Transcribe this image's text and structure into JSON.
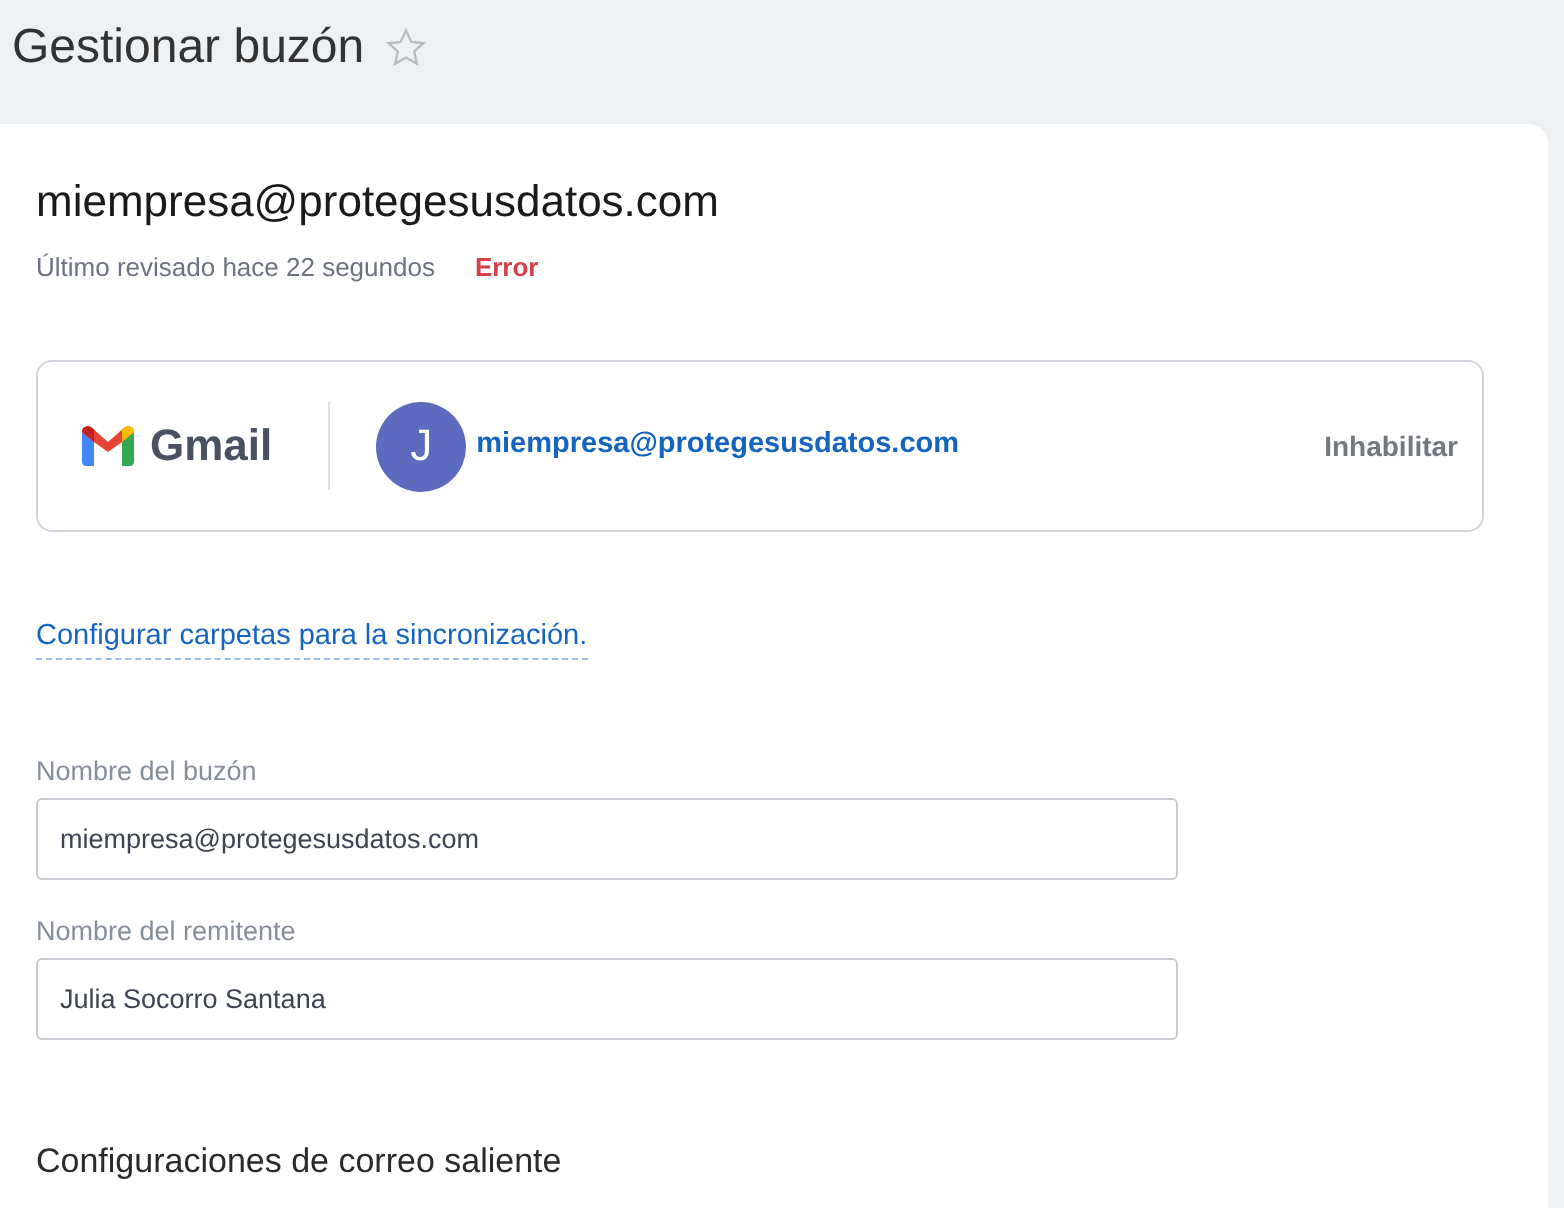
{
  "page": {
    "title": "Gestionar buzón",
    "favorite": false
  },
  "mailbox": {
    "address": "miempresa@protegesusdatos.com",
    "last_checked": "Último revisado hace 22 segundos",
    "status": "Error"
  },
  "account": {
    "provider": "Gmail",
    "avatar_letter": "J",
    "email": "miempresa@protegesusdatos.com",
    "action": "Inhabilitar"
  },
  "sync_link": "Configurar carpetas para la sincronización.",
  "fields": [
    {
      "label": "Nombre del buzón",
      "value": "miempresa@protegesusdatos.com"
    },
    {
      "label": "Nombre del remitente",
      "value": "Julia Socorro Santana"
    }
  ],
  "section_heading": "Configuraciones de correo saliente"
}
